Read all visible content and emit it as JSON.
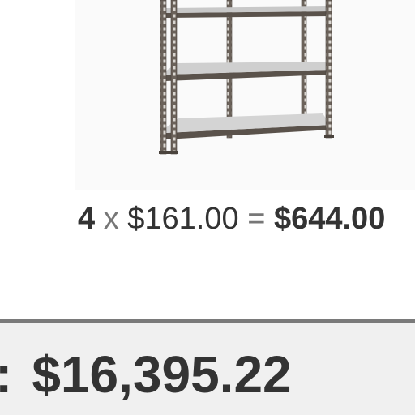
{
  "product": {
    "image_icon": "metal-shelving-unit",
    "quantity": "4",
    "times_symbol": "x",
    "unit_price": "$161.00",
    "equals_symbol": "=",
    "line_total": "$644.00"
  },
  "summary": {
    "label_tail": ":",
    "grand_total": "$16,395.22"
  },
  "colors": {
    "text": "#333333",
    "divider": "#7a7a7a",
    "summary_bg": "#f0f0f0"
  }
}
